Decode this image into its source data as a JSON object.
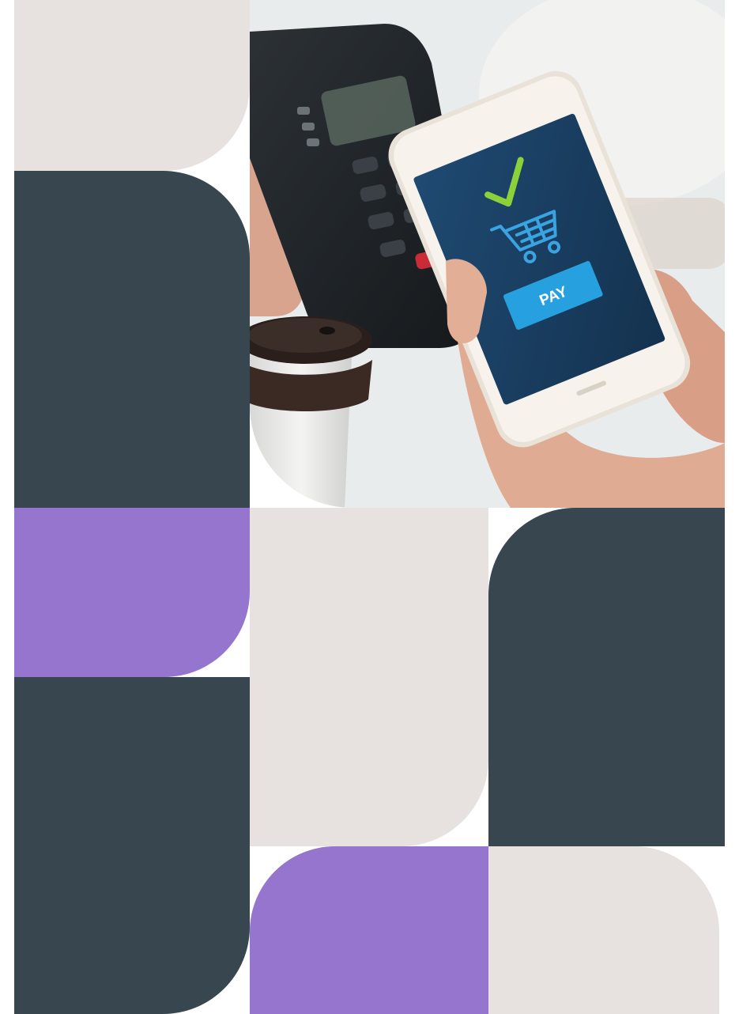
{
  "colors": {
    "beige": "#e7e2df",
    "dark_slate": "#37464f",
    "purple": "#9575cd"
  },
  "tiles": [
    {
      "name": "beige-top-left",
      "color": "beige"
    },
    {
      "name": "dark-left",
      "color": "dark_slate"
    },
    {
      "name": "purple-left",
      "color": "purple"
    },
    {
      "name": "dark-left-bottom",
      "color": "dark_slate"
    },
    {
      "name": "beige-middle",
      "color": "beige"
    },
    {
      "name": "purple-middle",
      "color": "purple"
    },
    {
      "name": "dark-right",
      "color": "dark_slate"
    },
    {
      "name": "beige-right",
      "color": "beige"
    }
  ],
  "photo": {
    "phone_screen": {
      "check_icon": "check-icon",
      "cart_icon": "shopping-cart-icon",
      "button_label": "PAY"
    }
  }
}
